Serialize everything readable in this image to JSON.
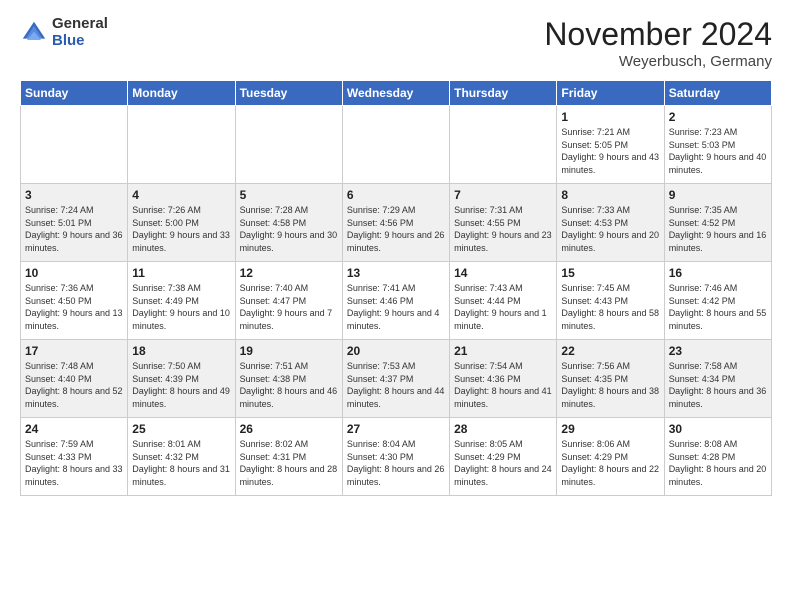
{
  "header": {
    "logo_line1": "General",
    "logo_line2": "Blue",
    "month_title": "November 2024",
    "location": "Weyerbusch, Germany"
  },
  "days_of_week": [
    "Sunday",
    "Monday",
    "Tuesday",
    "Wednesday",
    "Thursday",
    "Friday",
    "Saturday"
  ],
  "weeks": [
    [
      {
        "day": "",
        "info": ""
      },
      {
        "day": "",
        "info": ""
      },
      {
        "day": "",
        "info": ""
      },
      {
        "day": "",
        "info": ""
      },
      {
        "day": "",
        "info": ""
      },
      {
        "day": "1",
        "info": "Sunrise: 7:21 AM\nSunset: 5:05 PM\nDaylight: 9 hours and 43 minutes."
      },
      {
        "day": "2",
        "info": "Sunrise: 7:23 AM\nSunset: 5:03 PM\nDaylight: 9 hours and 40 minutes."
      }
    ],
    [
      {
        "day": "3",
        "info": "Sunrise: 7:24 AM\nSunset: 5:01 PM\nDaylight: 9 hours and 36 minutes."
      },
      {
        "day": "4",
        "info": "Sunrise: 7:26 AM\nSunset: 5:00 PM\nDaylight: 9 hours and 33 minutes."
      },
      {
        "day": "5",
        "info": "Sunrise: 7:28 AM\nSunset: 4:58 PM\nDaylight: 9 hours and 30 minutes."
      },
      {
        "day": "6",
        "info": "Sunrise: 7:29 AM\nSunset: 4:56 PM\nDaylight: 9 hours and 26 minutes."
      },
      {
        "day": "7",
        "info": "Sunrise: 7:31 AM\nSunset: 4:55 PM\nDaylight: 9 hours and 23 minutes."
      },
      {
        "day": "8",
        "info": "Sunrise: 7:33 AM\nSunset: 4:53 PM\nDaylight: 9 hours and 20 minutes."
      },
      {
        "day": "9",
        "info": "Sunrise: 7:35 AM\nSunset: 4:52 PM\nDaylight: 9 hours and 16 minutes."
      }
    ],
    [
      {
        "day": "10",
        "info": "Sunrise: 7:36 AM\nSunset: 4:50 PM\nDaylight: 9 hours and 13 minutes."
      },
      {
        "day": "11",
        "info": "Sunrise: 7:38 AM\nSunset: 4:49 PM\nDaylight: 9 hours and 10 minutes."
      },
      {
        "day": "12",
        "info": "Sunrise: 7:40 AM\nSunset: 4:47 PM\nDaylight: 9 hours and 7 minutes."
      },
      {
        "day": "13",
        "info": "Sunrise: 7:41 AM\nSunset: 4:46 PM\nDaylight: 9 hours and 4 minutes."
      },
      {
        "day": "14",
        "info": "Sunrise: 7:43 AM\nSunset: 4:44 PM\nDaylight: 9 hours and 1 minute."
      },
      {
        "day": "15",
        "info": "Sunrise: 7:45 AM\nSunset: 4:43 PM\nDaylight: 8 hours and 58 minutes."
      },
      {
        "day": "16",
        "info": "Sunrise: 7:46 AM\nSunset: 4:42 PM\nDaylight: 8 hours and 55 minutes."
      }
    ],
    [
      {
        "day": "17",
        "info": "Sunrise: 7:48 AM\nSunset: 4:40 PM\nDaylight: 8 hours and 52 minutes."
      },
      {
        "day": "18",
        "info": "Sunrise: 7:50 AM\nSunset: 4:39 PM\nDaylight: 8 hours and 49 minutes."
      },
      {
        "day": "19",
        "info": "Sunrise: 7:51 AM\nSunset: 4:38 PM\nDaylight: 8 hours and 46 minutes."
      },
      {
        "day": "20",
        "info": "Sunrise: 7:53 AM\nSunset: 4:37 PM\nDaylight: 8 hours and 44 minutes."
      },
      {
        "day": "21",
        "info": "Sunrise: 7:54 AM\nSunset: 4:36 PM\nDaylight: 8 hours and 41 minutes."
      },
      {
        "day": "22",
        "info": "Sunrise: 7:56 AM\nSunset: 4:35 PM\nDaylight: 8 hours and 38 minutes."
      },
      {
        "day": "23",
        "info": "Sunrise: 7:58 AM\nSunset: 4:34 PM\nDaylight: 8 hours and 36 minutes."
      }
    ],
    [
      {
        "day": "24",
        "info": "Sunrise: 7:59 AM\nSunset: 4:33 PM\nDaylight: 8 hours and 33 minutes."
      },
      {
        "day": "25",
        "info": "Sunrise: 8:01 AM\nSunset: 4:32 PM\nDaylight: 8 hours and 31 minutes."
      },
      {
        "day": "26",
        "info": "Sunrise: 8:02 AM\nSunset: 4:31 PM\nDaylight: 8 hours and 28 minutes."
      },
      {
        "day": "27",
        "info": "Sunrise: 8:04 AM\nSunset: 4:30 PM\nDaylight: 8 hours and 26 minutes."
      },
      {
        "day": "28",
        "info": "Sunrise: 8:05 AM\nSunset: 4:29 PM\nDaylight: 8 hours and 24 minutes."
      },
      {
        "day": "29",
        "info": "Sunrise: 8:06 AM\nSunset: 4:29 PM\nDaylight: 8 hours and 22 minutes."
      },
      {
        "day": "30",
        "info": "Sunrise: 8:08 AM\nSunset: 4:28 PM\nDaylight: 8 hours and 20 minutes."
      }
    ]
  ]
}
